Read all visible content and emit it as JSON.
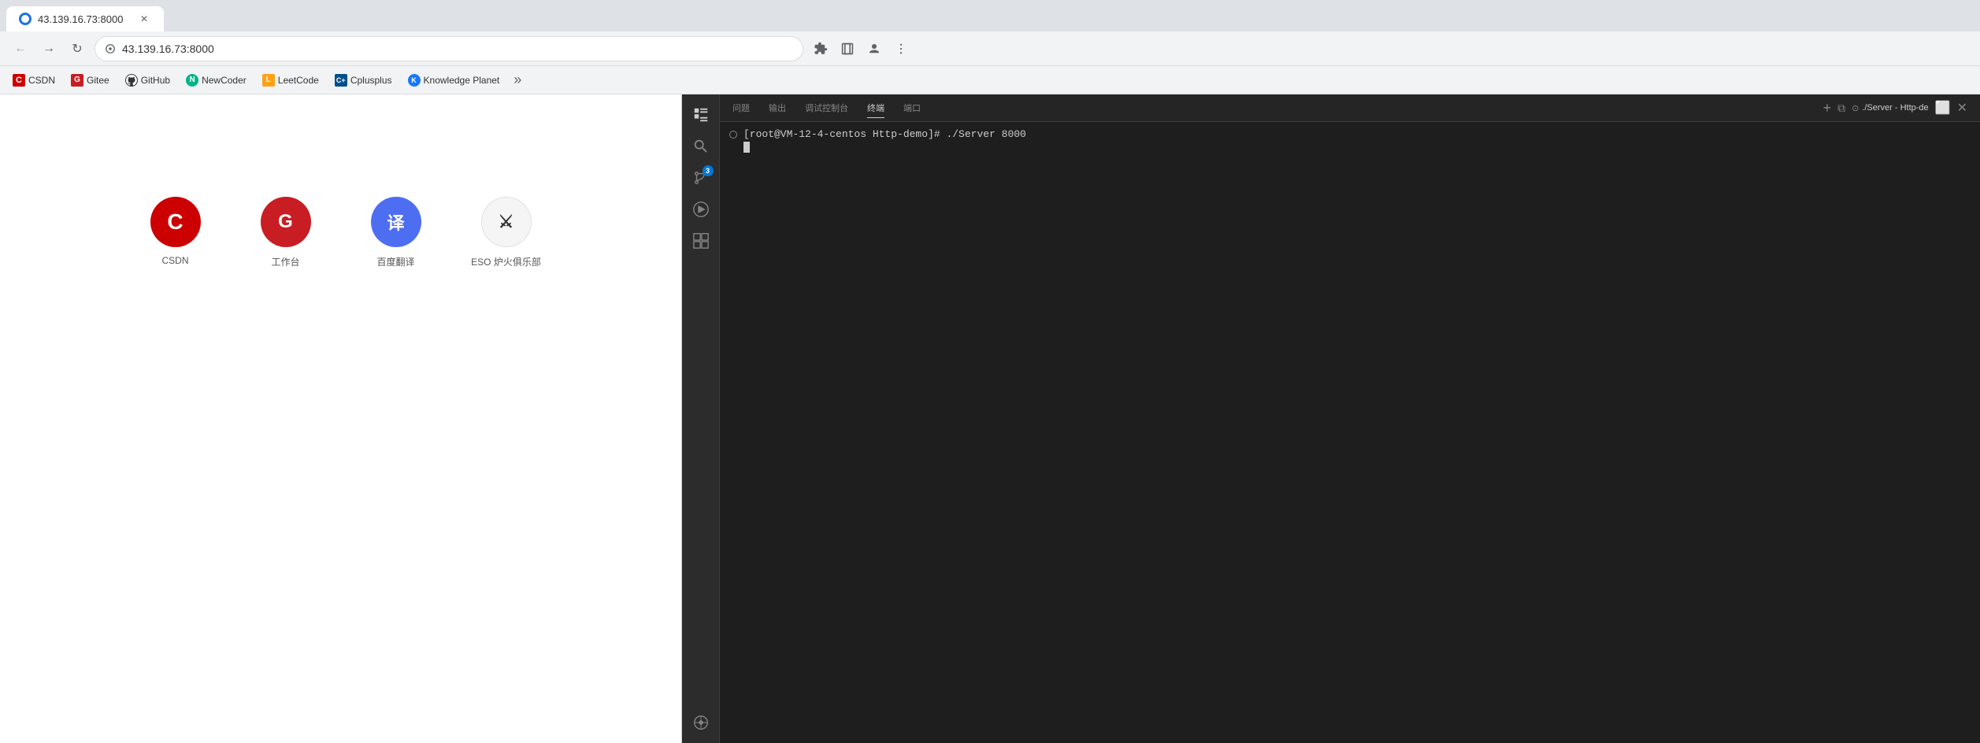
{
  "browser": {
    "tab": {
      "title": "43.139.16.73:8000",
      "url": "43.139.16.73:8000"
    },
    "bookmarks": [
      {
        "id": "csdn",
        "label": "CSDN",
        "color": "#cc0000",
        "letter": "C"
      },
      {
        "id": "gitee",
        "label": "Gitee",
        "color": "#c71d23",
        "letter": "G"
      },
      {
        "id": "github",
        "label": "GitHub",
        "color": "#333",
        "letter": ""
      },
      {
        "id": "newcoder",
        "label": "NewCoder",
        "color": "#00b38a",
        "letter": "N"
      },
      {
        "id": "leetcode",
        "label": "LeetCode",
        "color": "#ffa116",
        "letter": "L"
      },
      {
        "id": "cplusplus",
        "label": "Cplusplus",
        "color": "#004f8a",
        "letter": "C+"
      },
      {
        "id": "kplanet",
        "label": "Knowledge Planet",
        "color": "#1677ff",
        "letter": "K"
      }
    ]
  },
  "shortcuts": [
    {
      "id": "csdn",
      "label": "CSDN",
      "bg": "#cc0000",
      "letter": "C",
      "color": "white"
    },
    {
      "id": "gwork",
      "label": "工作台",
      "bg": "#c71d23",
      "letter": "G",
      "color": "white"
    },
    {
      "id": "baidu",
      "label": "百度翻译",
      "bg": "#4e6ef2",
      "letter": "译",
      "color": "white"
    },
    {
      "id": "eso",
      "label": "ESO 炉火俱乐部",
      "bg": "#2a2a2a",
      "letter": "⚔",
      "color": "#ccc"
    }
  ],
  "vscode": {
    "panel_tabs": [
      {
        "id": "problems",
        "label": "问题"
      },
      {
        "id": "output",
        "label": "输出"
      },
      {
        "id": "debug_console",
        "label": "调试控制台"
      },
      {
        "id": "terminal",
        "label": "终端",
        "active": true
      },
      {
        "id": "ports",
        "label": "端口"
      }
    ],
    "terminal_title": "./Server - Http-de",
    "terminal_content": "[root@VM-12-4-centos Http-demo]# ./Server 8000",
    "activity_icons": [
      {
        "id": "explorer",
        "symbol": "⧉",
        "active": false
      },
      {
        "id": "search",
        "symbol": "🔍",
        "active": false
      },
      {
        "id": "source-control",
        "symbol": "⑃",
        "badge": "3"
      },
      {
        "id": "run-debug",
        "symbol": "▷",
        "active": false
      },
      {
        "id": "extensions",
        "symbol": "⊞",
        "active": false
      },
      {
        "id": "remote",
        "symbol": "⊙",
        "active": false
      }
    ],
    "new_terminal_btn": "+",
    "split_terminal_btn": "⧉",
    "close_panel_btn": "✕",
    "maximize_panel_btn": "⬜"
  }
}
